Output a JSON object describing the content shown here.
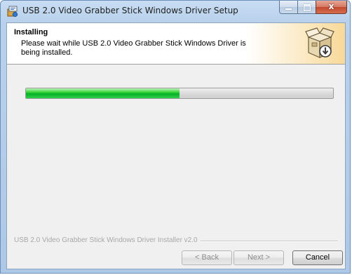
{
  "window": {
    "title": "USB 2.0 Video Grabber Stick Windows Driver Setup",
    "close_glyph": "x"
  },
  "header": {
    "title": "Installing",
    "subtitle": "Please wait while USB 2.0 Video Grabber Stick Windows Driver is being installed."
  },
  "progress": {
    "percent": 50,
    "color": "#06b025"
  },
  "footer": {
    "branding": "USB 2.0 Video Grabber Stick Windows Driver Installer v2.0"
  },
  "buttons": {
    "back": "< Back",
    "next": "Next >",
    "cancel": "Cancel"
  },
  "icons": {
    "app": "installer-app-icon",
    "header": "package-box-icon"
  }
}
